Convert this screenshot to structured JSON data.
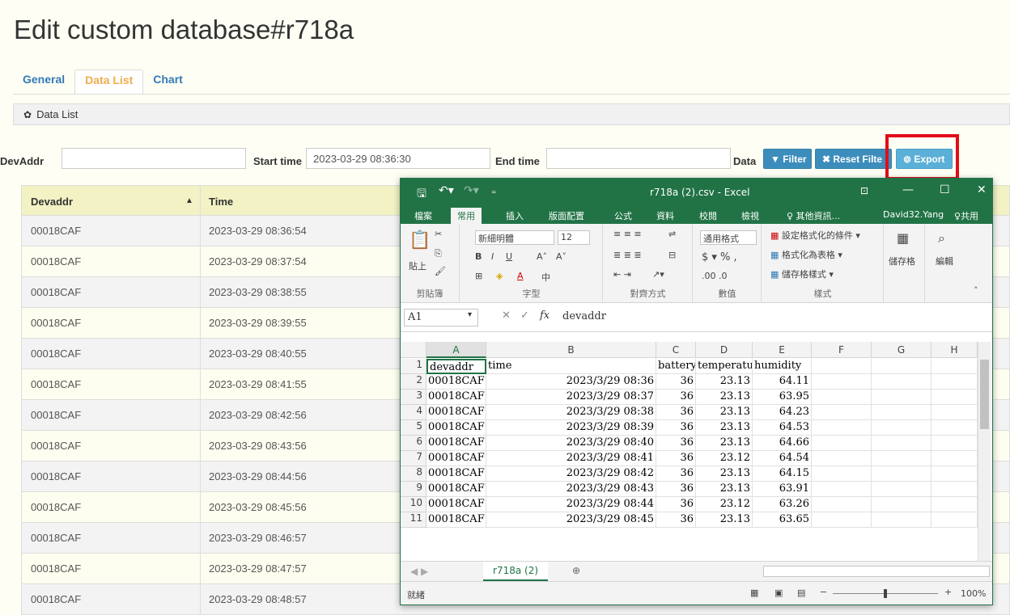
{
  "page": {
    "title": "Edit custom database#r718a",
    "tabs": [
      "General",
      "Data List",
      "Chart"
    ],
    "panel_title": "Data List"
  },
  "filters": {
    "devaddr_label": "DevAddr",
    "devaddr_value": "",
    "start_label": "Start time",
    "start_value": "2023-03-29 08:36:30",
    "end_label": "End time",
    "end_value": "",
    "data_label": "Data",
    "filter_btn": "Filter",
    "reset_btn": "Reset Filte",
    "export_btn": "Export"
  },
  "table": {
    "headers": [
      "Devaddr",
      "Time"
    ],
    "rows": [
      [
        "00018CAF",
        "2023-03-29 08:36:54"
      ],
      [
        "00018CAF",
        "2023-03-29 08:37:54"
      ],
      [
        "00018CAF",
        "2023-03-29 08:38:55"
      ],
      [
        "00018CAF",
        "2023-03-29 08:39:55"
      ],
      [
        "00018CAF",
        "2023-03-29 08:40:55"
      ],
      [
        "00018CAF",
        "2023-03-29 08:41:55"
      ],
      [
        "00018CAF",
        "2023-03-29 08:42:56"
      ],
      [
        "00018CAF",
        "2023-03-29 08:43:56"
      ],
      [
        "00018CAF",
        "2023-03-29 08:44:56"
      ],
      [
        "00018CAF",
        "2023-03-29 08:45:56"
      ],
      [
        "00018CAF",
        "2023-03-29 08:46:57"
      ],
      [
        "00018CAF",
        "2023-03-29 08:47:57"
      ],
      [
        "00018CAF",
        "2023-03-29 08:48:57"
      ]
    ]
  },
  "excel": {
    "window_title": "r718a (2).csv  -  Excel",
    "ribbon_tabs": [
      "檔案",
      "常用",
      "插入",
      "版面配置",
      "公式",
      "資料",
      "校閱",
      "檢視"
    ],
    "search": "♀ 其他資訊...",
    "user": "David32.Yang",
    "share": "共用",
    "font_name": "新細明體",
    "font_size": "12",
    "number_format": "通用格式",
    "styles_items": [
      "設定格式化的條件 ▾",
      "格式化為表格 ▾",
      "儲存格樣式 ▾"
    ],
    "cells_label": "儲存格",
    "edit_label": "編輯",
    "groups": [
      "剪貼簿",
      "字型",
      "對齊方式",
      "數值",
      "樣式"
    ],
    "paste_label": "貼上",
    "name_box": "A1",
    "formula": "devaddr",
    "columns": [
      "A",
      "B",
      "C",
      "D",
      "E",
      "F",
      "G",
      "H"
    ],
    "rows": [
      [
        "devaddr",
        "time",
        "battery",
        "temperature",
        "humidity"
      ],
      [
        "00018CAF",
        "2023/3/29 08:36",
        "36",
        "23.13",
        "64.11"
      ],
      [
        "00018CAF",
        "2023/3/29 08:37",
        "36",
        "23.13",
        "63.95"
      ],
      [
        "00018CAF",
        "2023/3/29 08:38",
        "36",
        "23.13",
        "64.23"
      ],
      [
        "00018CAF",
        "2023/3/29 08:39",
        "36",
        "23.13",
        "64.53"
      ],
      [
        "00018CAF",
        "2023/3/29 08:40",
        "36",
        "23.13",
        "64.66"
      ],
      [
        "00018CAF",
        "2023/3/29 08:41",
        "36",
        "23.12",
        "64.54"
      ],
      [
        "00018CAF",
        "2023/3/29 08:42",
        "36",
        "23.13",
        "64.15"
      ],
      [
        "00018CAF",
        "2023/3/29 08:43",
        "36",
        "23.13",
        "63.91"
      ],
      [
        "00018CAF",
        "2023/3/29 08:44",
        "36",
        "23.12",
        "63.26"
      ],
      [
        "00018CAF",
        "2023/3/29 08:45",
        "36",
        "23.13",
        "63.65"
      ]
    ],
    "sheet_tab": "r718a (2)",
    "status_text": "就緒",
    "zoom": "100%"
  }
}
